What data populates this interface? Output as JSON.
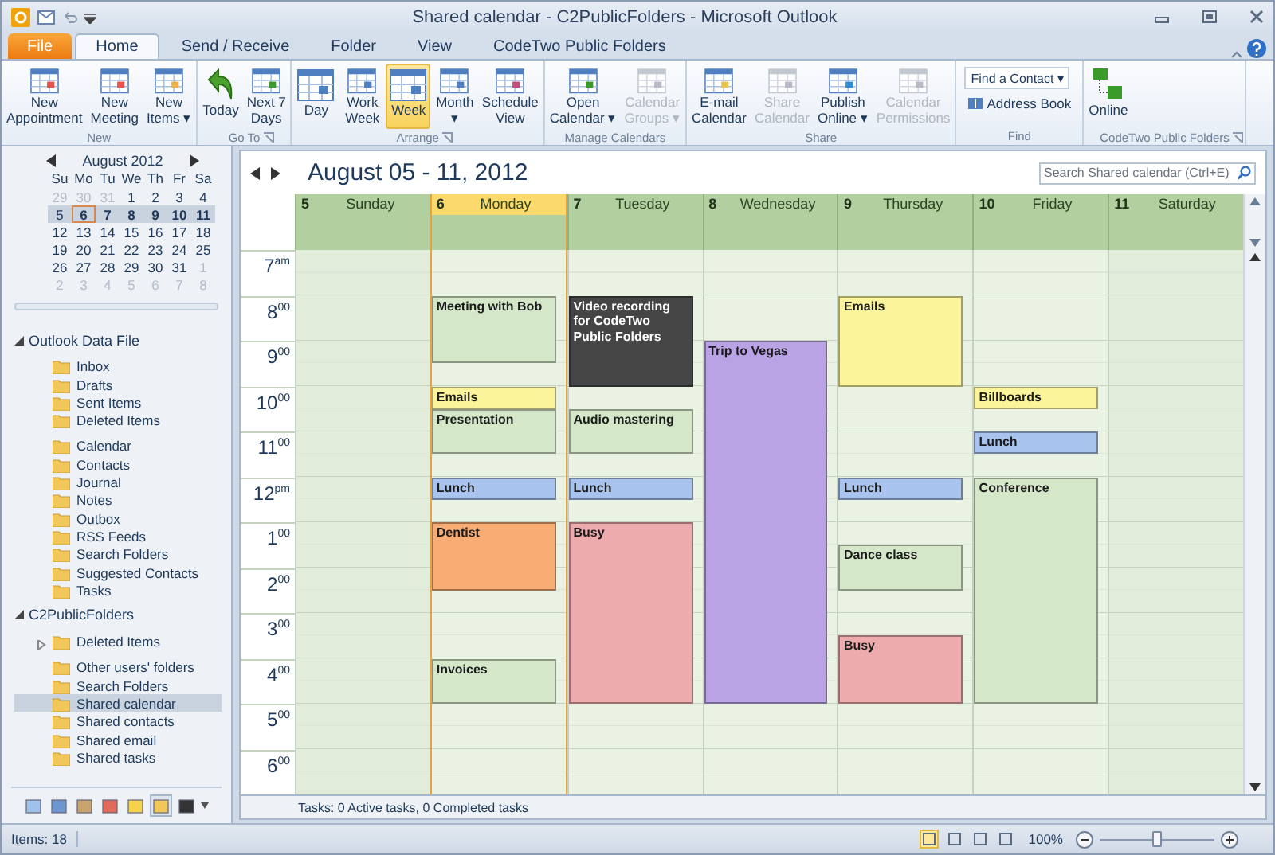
{
  "window": {
    "title": "Shared calendar - C2PublicFolders - Microsoft Outlook"
  },
  "ribbon_tabs": [
    {
      "label": "File",
      "kind": "file",
      "selected": false
    },
    {
      "label": "Home",
      "kind": "tab",
      "selected": true
    },
    {
      "label": "Send / Receive",
      "kind": "tab",
      "selected": false
    },
    {
      "label": "Folder",
      "kind": "tab",
      "selected": false
    },
    {
      "label": "View",
      "kind": "tab",
      "selected": false
    },
    {
      "label": "CodeTwo Public Folders",
      "kind": "tab",
      "selected": false
    }
  ],
  "ribbon_groups": [
    {
      "title": "New",
      "launcher": false,
      "buttons": [
        {
          "kind": "large",
          "label": "New\nAppointment",
          "disabled": false
        },
        {
          "kind": "large",
          "label": "New\nMeeting",
          "disabled": false
        },
        {
          "kind": "large",
          "label": "New\nItems ▾",
          "disabled": false
        }
      ]
    },
    {
      "title": "Go To",
      "launcher": true,
      "buttons": [
        {
          "kind": "large",
          "label": "Today",
          "disabled": false
        },
        {
          "kind": "large",
          "label": "Next 7\nDays",
          "disabled": false
        }
      ]
    },
    {
      "title": "Arrange",
      "launcher": true,
      "buttons": [
        {
          "kind": "large",
          "label": "Day",
          "disabled": false,
          "selected": false
        },
        {
          "kind": "large",
          "label": "Work\nWeek",
          "disabled": false,
          "selected": false
        },
        {
          "kind": "large",
          "label": "Week",
          "disabled": false,
          "selected": true
        },
        {
          "kind": "large",
          "label": "Month\n▾",
          "disabled": false,
          "selected": false
        },
        {
          "kind": "large",
          "label": "Schedule\nView",
          "disabled": false,
          "selected": false
        }
      ]
    },
    {
      "title": "Manage Calendars",
      "launcher": false,
      "buttons": [
        {
          "kind": "large",
          "label": "Open\nCalendar ▾",
          "disabled": false
        },
        {
          "kind": "large",
          "label": "Calendar\nGroups ▾",
          "disabled": true
        }
      ]
    },
    {
      "title": "Share",
      "launcher": false,
      "buttons": [
        {
          "kind": "large",
          "label": "E-mail\nCalendar",
          "disabled": false
        },
        {
          "kind": "large",
          "label": "Share\nCalendar",
          "disabled": true
        },
        {
          "kind": "large",
          "label": "Publish\nOnline ▾",
          "disabled": false
        },
        {
          "kind": "large",
          "label": "Calendar\nPermissions",
          "disabled": true
        }
      ]
    },
    {
      "title": "Find",
      "launcher": false,
      "buttons": [
        {
          "kind": "field",
          "label": "Find a Contact ▾"
        },
        {
          "kind": "small",
          "label": "Address Book"
        }
      ]
    },
    {
      "title": "CodeTwo Public Folders",
      "launcher": true,
      "buttons": [
        {
          "kind": "large",
          "label": "Online",
          "disabled": false
        }
      ]
    }
  ],
  "mini_calendar": {
    "title": "August 2012",
    "weekdays": [
      "Su",
      "Mo",
      "Tu",
      "We",
      "Th",
      "Fr",
      "Sa"
    ],
    "weeks": [
      {
        "selected": false,
        "days": [
          {
            "label": "29",
            "muted": true,
            "busy": false,
            "today": false
          },
          {
            "label": "30",
            "muted": true,
            "busy": false,
            "today": false
          },
          {
            "label": "31",
            "muted": true,
            "busy": false,
            "today": false
          },
          {
            "label": "1",
            "muted": false,
            "busy": false,
            "today": false
          },
          {
            "label": "2",
            "muted": false,
            "busy": false,
            "today": false
          },
          {
            "label": "3",
            "muted": false,
            "busy": false,
            "today": false
          },
          {
            "label": "4",
            "muted": false,
            "busy": false,
            "today": false
          }
        ]
      },
      {
        "selected": true,
        "days": [
          {
            "label": "5",
            "muted": false,
            "busy": false,
            "today": false
          },
          {
            "label": "6",
            "muted": false,
            "busy": true,
            "today": true
          },
          {
            "label": "7",
            "muted": false,
            "busy": true,
            "today": false
          },
          {
            "label": "8",
            "muted": false,
            "busy": true,
            "today": false
          },
          {
            "label": "9",
            "muted": false,
            "busy": true,
            "today": false
          },
          {
            "label": "10",
            "muted": false,
            "busy": true,
            "today": false
          },
          {
            "label": "11",
            "muted": false,
            "busy": true,
            "today": false
          }
        ]
      },
      {
        "selected": false,
        "days": [
          {
            "label": "12",
            "muted": false,
            "busy": false,
            "today": false
          },
          {
            "label": "13",
            "muted": false,
            "busy": false,
            "today": false
          },
          {
            "label": "14",
            "muted": false,
            "busy": false,
            "today": false
          },
          {
            "label": "15",
            "muted": false,
            "busy": false,
            "today": false
          },
          {
            "label": "16",
            "muted": false,
            "busy": false,
            "today": false
          },
          {
            "label": "17",
            "muted": false,
            "busy": false,
            "today": false
          },
          {
            "label": "18",
            "muted": false,
            "busy": false,
            "today": false
          }
        ]
      },
      {
        "selected": false,
        "days": [
          {
            "label": "19",
            "muted": false,
            "busy": false,
            "today": false
          },
          {
            "label": "20",
            "muted": false,
            "busy": false,
            "today": false
          },
          {
            "label": "21",
            "muted": false,
            "busy": false,
            "today": false
          },
          {
            "label": "22",
            "muted": false,
            "busy": false,
            "today": false
          },
          {
            "label": "23",
            "muted": false,
            "busy": false,
            "today": false
          },
          {
            "label": "24",
            "muted": false,
            "busy": false,
            "today": false
          },
          {
            "label": "25",
            "muted": false,
            "busy": false,
            "today": false
          }
        ]
      },
      {
        "selected": false,
        "days": [
          {
            "label": "26",
            "muted": false,
            "busy": false,
            "today": false
          },
          {
            "label": "27",
            "muted": false,
            "busy": false,
            "today": false
          },
          {
            "label": "28",
            "muted": false,
            "busy": false,
            "today": false
          },
          {
            "label": "29",
            "muted": false,
            "busy": false,
            "today": false
          },
          {
            "label": "30",
            "muted": false,
            "busy": false,
            "today": false
          },
          {
            "label": "31",
            "muted": false,
            "busy": false,
            "today": false
          },
          {
            "label": "1",
            "muted": true,
            "busy": false,
            "today": false
          }
        ]
      },
      {
        "selected": false,
        "days": [
          {
            "label": "2",
            "muted": true,
            "busy": false,
            "today": false
          },
          {
            "label": "3",
            "muted": true,
            "busy": false,
            "today": false
          },
          {
            "label": "4",
            "muted": true,
            "busy": false,
            "today": false
          },
          {
            "label": "5",
            "muted": true,
            "busy": false,
            "today": false
          },
          {
            "label": "6",
            "muted": true,
            "busy": false,
            "today": false
          },
          {
            "label": "7",
            "muted": true,
            "busy": false,
            "today": false
          },
          {
            "label": "8",
            "muted": true,
            "busy": false,
            "today": false
          }
        ]
      }
    ]
  },
  "folders": [
    {
      "label": "Outlook Data File",
      "expanded": true,
      "children": [
        {
          "label": "Inbox",
          "selected": false,
          "gap_before": false
        },
        {
          "label": "Drafts",
          "selected": false,
          "gap_before": false
        },
        {
          "label": "Sent Items",
          "selected": false,
          "gap_before": false
        },
        {
          "label": "Deleted Items",
          "selected": false,
          "gap_before": false
        },
        {
          "label": "Calendar",
          "selected": false,
          "gap_before": true
        },
        {
          "label": "Contacts",
          "selected": false,
          "gap_before": false
        },
        {
          "label": "Journal",
          "selected": false,
          "gap_before": false
        },
        {
          "label": "Notes",
          "selected": false,
          "gap_before": false
        },
        {
          "label": "Outbox",
          "selected": false,
          "gap_before": false
        },
        {
          "label": "RSS Feeds",
          "selected": false,
          "gap_before": false
        },
        {
          "label": "Search Folders",
          "selected": false,
          "gap_before": false
        },
        {
          "label": "Suggested Contacts",
          "selected": false,
          "gap_before": false
        },
        {
          "label": "Tasks",
          "selected": false,
          "gap_before": false
        }
      ]
    },
    {
      "label": "C2PublicFolders",
      "expanded": true,
      "children": [
        {
          "label": "Deleted Items",
          "selected": false,
          "gap_before": false,
          "expanded": false
        },
        {
          "label": "Other users' folders",
          "selected": false,
          "gap_before": true
        },
        {
          "label": "Search Folders",
          "selected": false,
          "gap_before": false
        },
        {
          "label": "Shared calendar",
          "selected": true,
          "gap_before": false
        },
        {
          "label": "Shared contacts",
          "selected": false,
          "gap_before": false
        },
        {
          "label": "Shared email",
          "selected": false,
          "gap_before": false
        },
        {
          "label": "Shared tasks",
          "selected": false,
          "gap_before": false
        }
      ]
    }
  ],
  "nav_buttons": [
    {
      "selected": false
    },
    {
      "selected": false
    },
    {
      "selected": false
    },
    {
      "selected": false
    },
    {
      "selected": false
    },
    {
      "selected": true
    },
    {
      "selected": false
    }
  ],
  "calendar": {
    "title": "August 05 - 11, 2012",
    "search": {
      "placeholder": "Search Shared calendar (Ctrl+E)"
    },
    "hours": [
      "7$^{am}$",
      "8$^{00}$",
      "9$^{00}$",
      "10$^{00}$",
      "11$^{00}$",
      "12$^{pm}$",
      "1$^{00}$",
      "2$^{00}$",
      "3$^{00}$",
      "4$^{00}$",
      "5$^{00}$",
      "6$^{00}$"
    ],
    "days": [
      {
        "number": "5",
        "name": "Sunday",
        "selected": false
      },
      {
        "number": "6",
        "name": "Monday",
        "selected": true,
        "slots": [
          {
            "kind": "free"
          },
          {
            "kind": "free"
          },
          {
            "kind": "event",
            "title": "Meeting with Bob",
            "color": "#d4e7c8"
          },
          {
            "kind": "more"
          },
          {
            "kind": "more"
          },
          {
            "kind": "free"
          },
          {
            "kind": "event",
            "title": "Emails",
            "color": "#fbf49a"
          },
          {
            "kind": "event",
            "title": "Presentation",
            "color": "#d4e7c8"
          },
          {
            "kind": "more"
          },
          {
            "kind": "free"
          },
          {
            "kind": "event",
            "title": "Lunch",
            "color": "#a8c3ee"
          },
          {
            "kind": "free"
          },
          {
            "kind": "event",
            "title": "Dentist",
            "color": "#f7ad74"
          },
          {
            "kind": "more"
          },
          {
            "kind": "more"
          },
          {
            "kind": "free"
          },
          {
            "kind": "free"
          },
          {
            "kind": "free"
          },
          {
            "kind": "event",
            "title": "Invoices",
            "color": "#d4e7c8"
          },
          {
            "kind": "more"
          }
        ]
      },
      {
        "number": "7",
        "name": "Tuesday",
        "selected": false,
        "slots": [
          {
            "kind": "free"
          },
          {
            "kind": "free"
          },
          {
            "kind": "event",
            "title": "Video recording for CodeTwo Public Folders",
            "color": "#454545"
          },
          {
            "kind": "more"
          },
          {
            "kind": "more"
          },
          {
            "kind": "more"
          },
          {
            "kind": "free"
          },
          {
            "kind": "event",
            "title": "Audio mastering",
            "color": "#d4e7c8"
          },
          {
            "kind": "more"
          },
          {
            "kind": "free"
          },
          {
            "kind": "event",
            "title": "Lunch",
            "color": "#a8c3ee"
          },
          {
            "kind": "free"
          },
          {
            "kind": "event",
            "title": "Busy",
            "color": "#eeabae"
          },
          {
            "kind": "more"
          },
          {
            "kind": "more"
          },
          {
            "kind": "more"
          },
          {
            "kind": "more"
          },
          {
            "kind": "more"
          },
          {
            "kind": "more"
          },
          {
            "kind": "more"
          }
        ]
      },
      {
        "number": "8",
        "name": "Wednesday",
        "selected": false,
        "slots": [
          {
            "kind": "free"
          },
          {
            "kind": "free"
          },
          {
            "kind": "free"
          },
          {
            "kind": "free"
          },
          {
            "kind": "event",
            "title": "Trip to Vegas",
            "color": "#b9a3e4"
          },
          {
            "kind": "more"
          },
          {
            "kind": "more"
          },
          {
            "kind": "more"
          },
          {
            "kind": "more"
          },
          {
            "kind": "more"
          },
          {
            "kind": "more"
          },
          {
            "kind": "more"
          },
          {
            "kind": "more"
          },
          {
            "kind": "more"
          },
          {
            "kind": "more"
          },
          {
            "kind": "more"
          },
          {
            "kind": "more"
          },
          {
            "kind": "more"
          },
          {
            "kind": "more"
          },
          {
            "kind": "more"
          }
        ]
      },
      {
        "number": "9",
        "name": "Thursday",
        "selected": false,
        "slots": [
          {
            "kind": "free"
          },
          {
            "kind": "free"
          },
          {
            "kind": "event",
            "title": "Emails",
            "color": "#fbf49a"
          },
          {
            "kind": "more"
          },
          {
            "kind": "more"
          },
          {
            "kind": "more"
          },
          {
            "kind": "free"
          },
          {
            "kind": "free"
          },
          {
            "kind": "free"
          },
          {
            "kind": "free"
          },
          {
            "kind": "event",
            "title": "Lunch",
            "color": "#a8c3ee"
          },
          {
            "kind": "free"
          },
          {
            "kind": "free"
          },
          {
            "kind": "event",
            "title": "Dance class",
            "color": "#d4e7c8"
          },
          {
            "kind": "more"
          },
          {
            "kind": "free"
          },
          {
            "kind": "free"
          },
          {
            "kind": "event",
            "title": "Busy",
            "color": "#eeabae"
          },
          {
            "kind": "more"
          },
          {
            "kind": "more"
          }
        ]
      },
      {
        "number": "10",
        "name": "Friday",
        "selected": false,
        "slots": [
          {
            "kind": "free"
          },
          {
            "kind": "free"
          },
          {
            "kind": "free"
          },
          {
            "kind": "free"
          },
          {
            "kind": "free"
          },
          {
            "kind": "free"
          },
          {
            "kind": "event",
            "title": "Billboards",
            "color": "#fbf49a"
          },
          {
            "kind": "free"
          },
          {
            "kind": "event",
            "title": "Lunch",
            "color": "#a8c3ee"
          },
          {
            "kind": "free"
          },
          {
            "kind": "event",
            "title": "Conference",
            "color": "#d4e7c8"
          },
          {
            "kind": "more"
          },
          {
            "kind": "more"
          },
          {
            "kind": "more"
          },
          {
            "kind": "more"
          },
          {
            "kind": "more"
          },
          {
            "kind": "more"
          },
          {
            "kind": "more"
          },
          {
            "kind": "more"
          },
          {
            "kind": "more"
          }
        ]
      },
      {
        "number": "11",
        "name": "Saturday",
        "selected": false
      }
    ],
    "tasks_bar": "Tasks: 0 Active tasks, 0 Completed tasks"
  },
  "status_bar": {
    "items": "Items: 18",
    "views": [
      {
        "selected": true
      },
      {
        "selected": false
      },
      {
        "selected": false
      },
      {
        "selected": false
      }
    ],
    "zoom": "100%",
    "zoom_slider": {
      "level": 0.5
    }
  }
}
